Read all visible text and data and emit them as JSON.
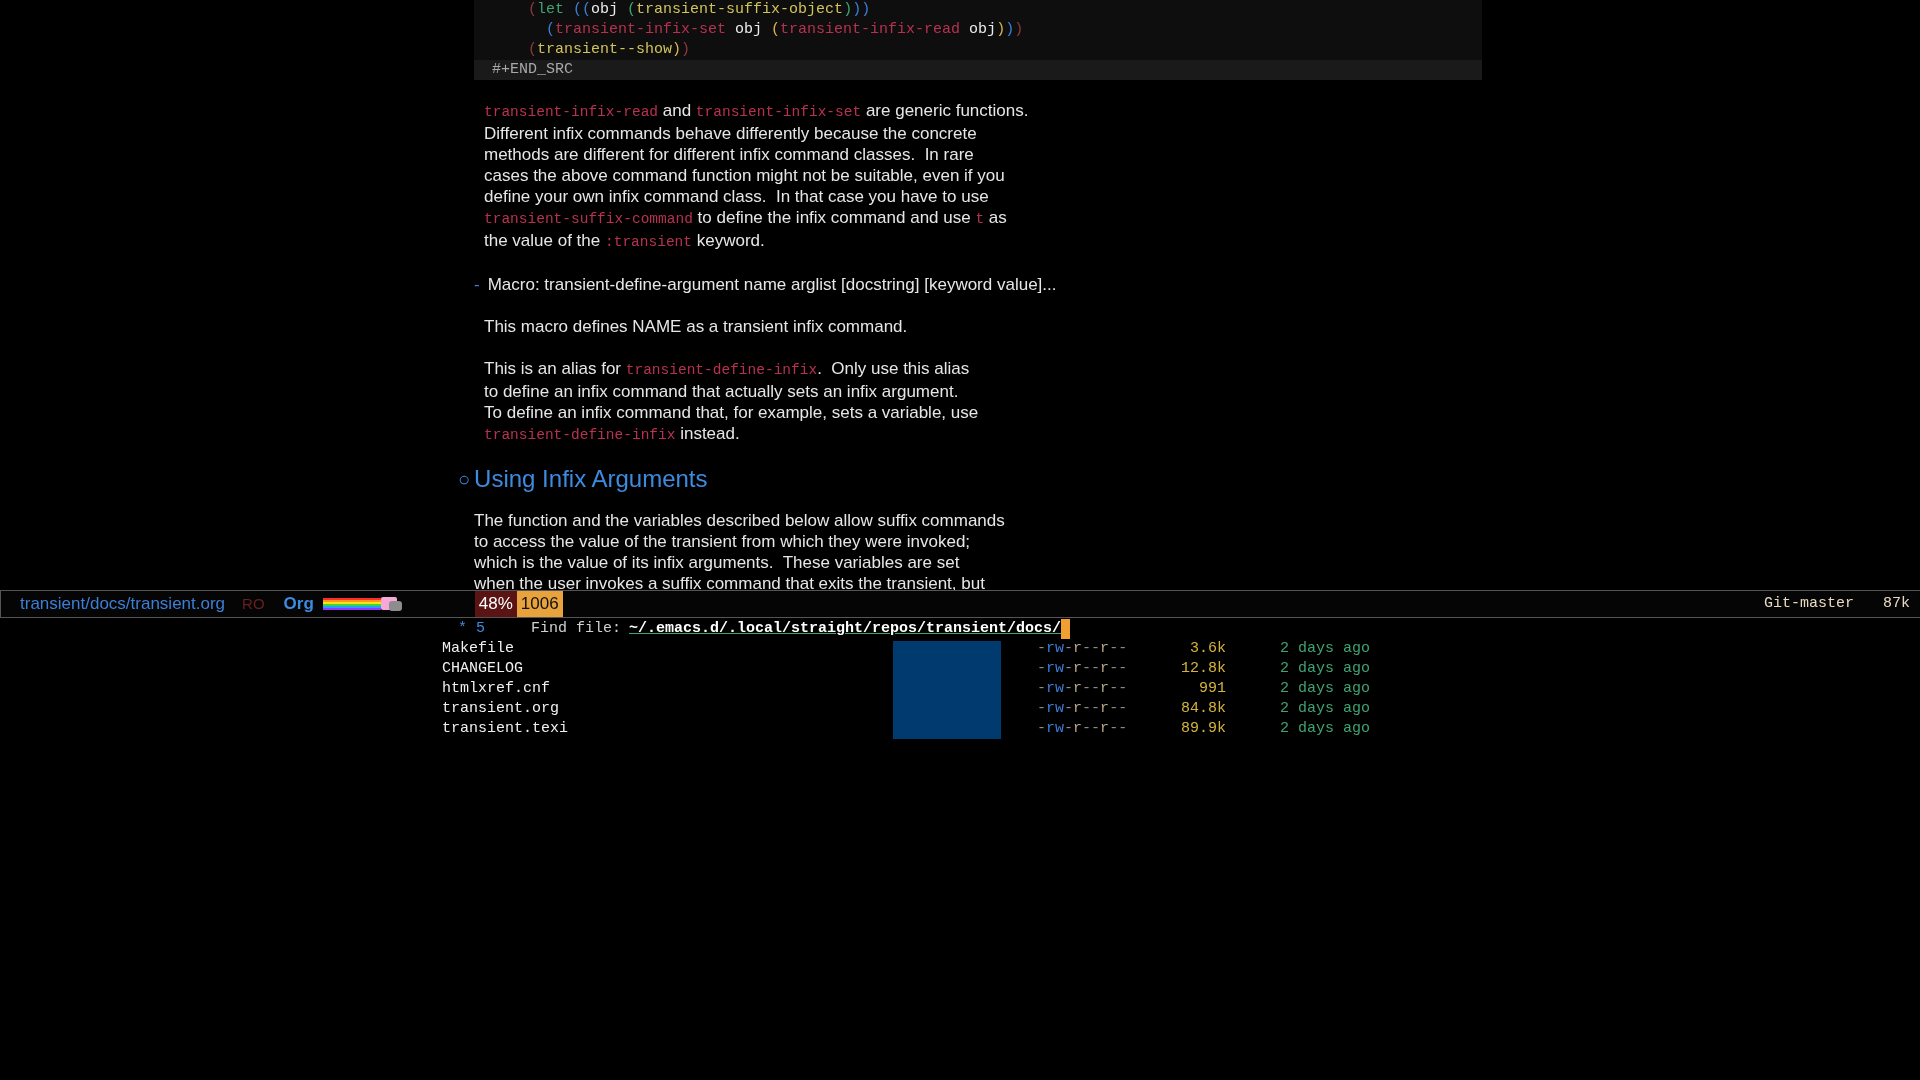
{
  "code_block": {
    "lines": [
      [
        {
          "text": "    (",
          "kind": "p1"
        },
        {
          "text": "let ",
          "kind": "kw"
        },
        {
          "text": "((",
          "kind": "p2"
        },
        {
          "text": "obj ",
          "kind": "plain"
        },
        {
          "text": "(",
          "kind": "p3"
        },
        {
          "text": "transient-suffix-object",
          "kind": "fy"
        },
        {
          "text": ")",
          "kind": "p3"
        },
        {
          "text": "))",
          "kind": "p2"
        }
      ],
      [
        {
          "text": "      (",
          "kind": "p2"
        },
        {
          "text": "transient-infix-set",
          "kind": "fn"
        },
        {
          "text": " obj ",
          "kind": "plain"
        },
        {
          "text": "(",
          "kind": "p4"
        },
        {
          "text": "transient-infix-read",
          "kind": "fn"
        },
        {
          "text": " obj",
          "kind": "plain"
        },
        {
          "text": ")",
          "kind": "p4"
        },
        {
          "text": ")",
          "kind": "p2"
        },
        {
          "text": ")",
          "kind": "p1"
        }
      ],
      [
        {
          "text": "    (",
          "kind": "p1"
        },
        {
          "text": "transient--show",
          "kind": "fy"
        },
        {
          "text": ")",
          "kind": "p4"
        },
        {
          "text": ")",
          "kind": "p1"
        }
      ]
    ],
    "end_marker": "#+END_SRC"
  },
  "document": [
    {
      "kind": "paragraph",
      "lines": [
        [
          {
            "kind": "code",
            "text": "transient-infix-read"
          },
          {
            "kind": "text",
            "text": " and "
          },
          {
            "kind": "code",
            "text": "transient-infix-set"
          },
          {
            "kind": "text",
            "text": " are generic functions."
          }
        ],
        [
          {
            "kind": "text",
            "text": "Different infix commands behave differently because the concrete"
          }
        ],
        [
          {
            "kind": "text",
            "text": "methods are different for different infix command classes.  In rare"
          }
        ],
        [
          {
            "kind": "text",
            "text": "cases the above command function might not be suitable, even if you"
          }
        ],
        [
          {
            "kind": "text",
            "text": "define your own infix command class.  In that case you have to use"
          }
        ],
        [
          {
            "kind": "code",
            "text": "transient-suffix-command"
          },
          {
            "kind": "text",
            "text": " to define the infix command and use "
          },
          {
            "kind": "code",
            "text": "t"
          },
          {
            "kind": "text",
            "text": " as"
          }
        ],
        [
          {
            "kind": "text",
            "text": "the value of the "
          },
          {
            "kind": "code",
            "text": ":transient"
          },
          {
            "kind": "text",
            "text": " keyword."
          }
        ]
      ]
    },
    {
      "kind": "macro",
      "bullet": "-",
      "text": "Macro: transient-define-argument name arglist [docstring] [keyword value]..."
    },
    {
      "kind": "paragraph",
      "lines": [
        [
          {
            "kind": "text",
            "text": "This macro defines NAME as a transient infix command."
          }
        ]
      ]
    },
    {
      "kind": "paragraph",
      "lines": [
        [
          {
            "kind": "text",
            "text": "This is an alias for "
          },
          {
            "kind": "code",
            "text": "transient-define-infix"
          },
          {
            "kind": "text",
            "text": ".  Only use this alias"
          }
        ],
        [
          {
            "kind": "text",
            "text": "to define an infix command that actually sets an infix argument."
          }
        ],
        [
          {
            "kind": "text",
            "text": "To define an infix command that, for example, sets a variable, use"
          }
        ],
        [
          {
            "kind": "code",
            "text": "transient-define-infix"
          },
          {
            "kind": "text",
            "text": " instead."
          }
        ]
      ]
    },
    {
      "kind": "heading",
      "bullet": "○",
      "text": "Using Infix Arguments",
      "children": [
        {
          "kind": "paragraph",
          "lines": [
            [
              {
                "kind": "text",
                "text": "The function and the variables described below allow suffix commands"
              }
            ],
            [
              {
                "kind": "text",
                "text": "to access the value of the transient from which they were invoked;"
              }
            ],
            [
              {
                "kind": "text",
                "text": "which is the value of its infix arguments.  These variables are set"
              }
            ],
            [
              {
                "kind": "text",
                "text": "when the user invokes a suffix command that exits the transient, but"
              }
            ]
          ]
        }
      ]
    }
  ],
  "mode_line": {
    "buffer": "transient/docs/transient.org",
    "read_only": "RO",
    "major_mode": "Org",
    "percent": "48%",
    "line": "1006",
    "vcs": "Git-master",
    "size": "87k"
  },
  "minibuffer": {
    "count": "* 5",
    "prompt": "Find file:",
    "input": "~/.emacs.d/.local/straight/repos/transient/docs/",
    "files": [
      {
        "name": "Makefile",
        "permissions": "-rw-r--r--",
        "size": "3.6k",
        "modified": "2 days ago"
      },
      {
        "name": "CHANGELOG",
        "permissions": "-rw-r--r--",
        "size": "12.8k",
        "modified": "2 days ago"
      },
      {
        "name": "htmlxref.cnf",
        "permissions": "-rw-r--r--",
        "size": "991",
        "modified": "2 days ago"
      },
      {
        "name": "transient.org",
        "permissions": "-rw-r--r--",
        "size": "84.8k",
        "modified": "2 days ago"
      },
      {
        "name": "transient.texi",
        "permissions": "-rw-r--r--",
        "size": "89.9k",
        "modified": "2 days ago"
      }
    ]
  }
}
